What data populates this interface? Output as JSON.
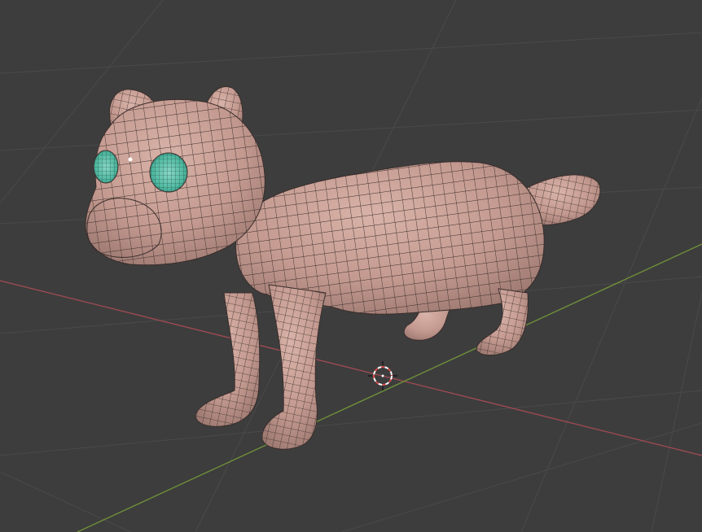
{
  "viewport": {
    "background": "#3d3d3d",
    "grid_color": "#4a4a4a",
    "x_axis_color": "#9c4a52",
    "y_axis_color": "#6f8f3a"
  },
  "model": {
    "name": "cat-mesh",
    "skin_color": "#c49a90",
    "wire_color": "#3a2e2c",
    "eye_color": "#4fb8a0",
    "view_mode": "wireframe-over-solid"
  },
  "cursor": {
    "icon": "3d-cursor-icon",
    "colors": [
      "#d84a4a",
      "#ffffff"
    ]
  }
}
